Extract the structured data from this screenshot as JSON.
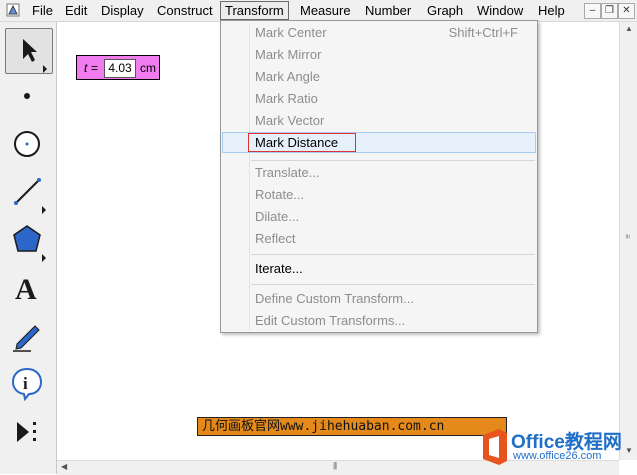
{
  "menubar": {
    "items": [
      {
        "label": "File"
      },
      {
        "label": "Edit"
      },
      {
        "label": "Display"
      },
      {
        "label": "Construct"
      },
      {
        "label": "Transform"
      },
      {
        "label": "Measure"
      },
      {
        "label": "Number"
      },
      {
        "label": "Graph"
      },
      {
        "label": "Window"
      },
      {
        "label": "Help"
      }
    ],
    "window_buttons": {
      "minimize": "–",
      "restore": "❐",
      "close": "✕"
    }
  },
  "toolbox": {
    "tools": [
      {
        "name": "selection-arrow-tool",
        "selected": true
      },
      {
        "name": "point-tool"
      },
      {
        "name": "compass-tool"
      },
      {
        "name": "straightedge-tool"
      },
      {
        "name": "polygon-tool"
      },
      {
        "name": "text-tool",
        "glyph": "A"
      },
      {
        "name": "marker-tool"
      },
      {
        "name": "information-tool",
        "glyph": "i"
      },
      {
        "name": "custom-tool"
      }
    ]
  },
  "canvas": {
    "parameter": {
      "name": "t",
      "equals": "=",
      "value": "4.03",
      "unit": "cm"
    },
    "watermark": "几何画板官网www.jihehuaban.com.cn"
  },
  "transform_menu": {
    "groups": [
      [
        {
          "label": "Mark Center",
          "shortcut": "Shift+Ctrl+F",
          "enabled": false
        },
        {
          "label": "Mark Mirror",
          "enabled": false
        },
        {
          "label": "Mark Angle",
          "enabled": false
        },
        {
          "label": "Mark Ratio",
          "enabled": false
        },
        {
          "label": "Mark Vector",
          "enabled": false
        },
        {
          "label": "Mark Distance",
          "enabled": true,
          "hovered": true
        }
      ],
      [
        {
          "label": "Translate...",
          "enabled": false
        },
        {
          "label": "Rotate...",
          "enabled": false
        },
        {
          "label": "Dilate...",
          "enabled": false
        },
        {
          "label": "Reflect",
          "enabled": false
        }
      ],
      [
        {
          "label": "Iterate...",
          "enabled": true
        }
      ],
      [
        {
          "label": "Define Custom Transform...",
          "enabled": false
        },
        {
          "label": "Edit Custom Transforms...",
          "enabled": false
        }
      ]
    ]
  },
  "logo": {
    "line1": "Office教程网",
    "line2": "www.office26.com"
  },
  "colors": {
    "parameter_bg": "#f07cf0",
    "watermark_bg": "#e58a1a",
    "highlight": "#e03030",
    "hover": "#e6f0fb"
  }
}
